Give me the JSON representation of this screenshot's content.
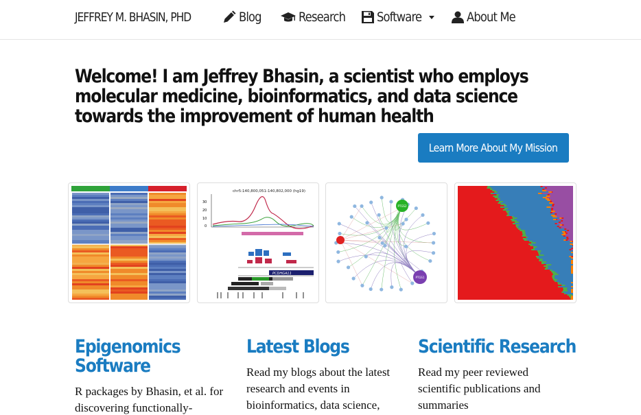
{
  "navbar": {
    "brand": "JEFFREY M. BHASIN, PHD",
    "items": [
      {
        "label": "Blog",
        "icon": "pencil-icon"
      },
      {
        "label": "Research",
        "icon": "graduation-cap-icon"
      },
      {
        "label": "Software",
        "icon": "floppy-disk-icon",
        "dropdown": true
      },
      {
        "label": "About Me",
        "icon": "user-icon"
      }
    ]
  },
  "hero": {
    "welcome": "Welcome! I am Jeffrey Bhasin, a scientist who employs molecular medicine, bioinformatics, and data science towards the improvement of human health",
    "mission_button": "Learn More About My Mission"
  },
  "thumbnails": {
    "genome_plot": {
      "coordinate_label": "chr5:140,800,051-140,802,000 (hg19)",
      "y_ticks": [
        "30",
        "20",
        "10",
        "0"
      ],
      "gene_label": "PCDHGA11"
    },
    "network_plot": {
      "center_nodes": [
        "PTGS2",
        "PTGS1"
      ]
    }
  },
  "columns": [
    {
      "title": "Epigenomics Software",
      "text": "R packages by Bhasin, et al. for discovering functionally-"
    },
    {
      "title": "Latest Blogs",
      "text": "Read my blogs about the latest research and events in bioinformatics, data science,"
    },
    {
      "title": "Scientific Research",
      "text": "Read my peer reviewed scientific publications and summaries"
    }
  ],
  "colors": {
    "link_blue": "#1a7cc1",
    "button_blue": "#1a7cc1",
    "text_dark": "#111111"
  }
}
